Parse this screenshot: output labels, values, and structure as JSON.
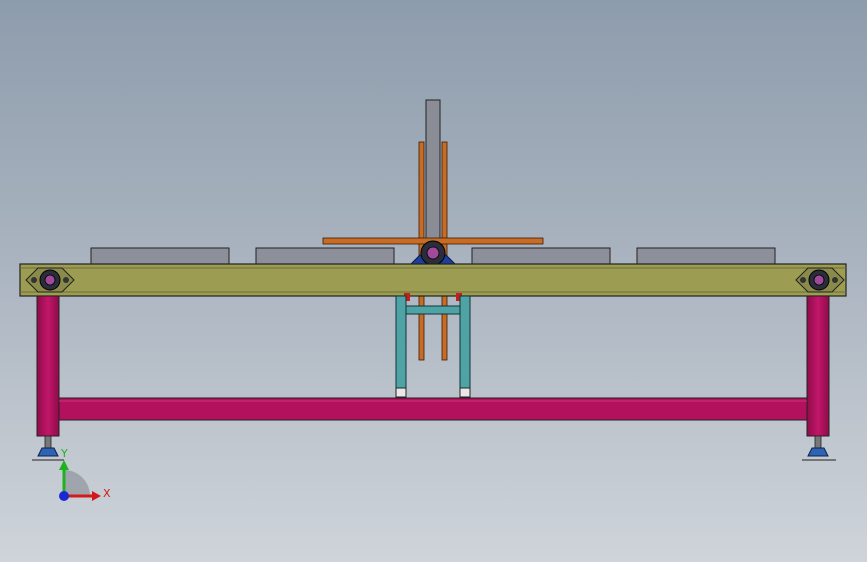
{
  "triad": {
    "y_label": "Y",
    "x_label": "X",
    "colors": {
      "x": "#d21a1a",
      "y": "#1fb21f",
      "z": "#1a2ad2"
    }
  },
  "colors": {
    "frame": "#b3105e",
    "conveyor_plate": "#9c9c52",
    "carrier": "#8d8f9a",
    "arm": "#c86b24",
    "support": "#4fa3a5",
    "foot": "#2d62b4",
    "column": "#8b8d96",
    "bearing": "#1c3f9e"
  }
}
